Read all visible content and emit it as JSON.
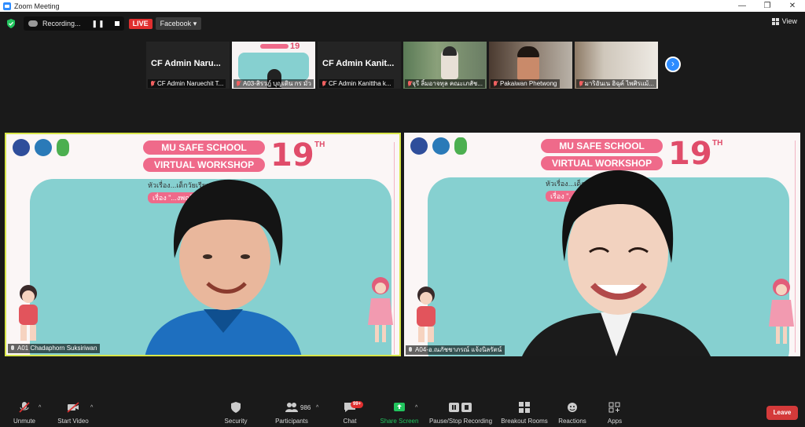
{
  "window": {
    "title": "Zoom Meeting",
    "minimize": "—",
    "maximize": "❐",
    "close": "✕"
  },
  "topbar": {
    "recording_label": "Recording...",
    "live_label": "LIVE",
    "stream_target": "Facebook",
    "stream_caret": "▾",
    "view_label": "View"
  },
  "thumbnails": [
    {
      "big_name": "CF Admin Naru...",
      "label": "CF Admin Naruechit T...",
      "kind": "name"
    },
    {
      "big_name": "",
      "label": "A03-สิรวฎ์ บุญเดิน กร มั่ว",
      "kind": "slide"
    },
    {
      "big_name": "CF Admin Kanit...",
      "label": "CF Admin Kanittha k...",
      "kind": "name"
    },
    {
      "big_name": "",
      "label": "จุรี ลิ้มอาจทุล คณะเภสัช...",
      "kind": "video"
    },
    {
      "big_name": "",
      "label": "Pakaiwan Phetwong",
      "kind": "video"
    },
    {
      "big_name": "",
      "label": "มาริอันเน ฮิฉุค์ ไพศิรแม้...",
      "kind": "video"
    }
  ],
  "next_arrow": "›",
  "tiles": [
    {
      "name": "A01 Chadaphorn Suksiriwan",
      "title_line1": "MU SAFE SCHOOL",
      "title_line2": "VIRTUAL WORKSHOP",
      "edition": "19",
      "edition_suffix": "TH",
      "subtitle1": "หัวเรื่อง...เด็กวัยเรียน(1)\"",
      "subtitle2": "เรื่อง \"...งพฤติกรรม\""
    },
    {
      "name": "A04-อ.ณภัชชาภรณ์ แจ้งนิลรัตน์",
      "title_line1": "MU SAFE SCHOOL",
      "title_line2": "VIRTUAL WORKSHOP",
      "edition": "19",
      "edition_suffix": "TH",
      "subtitle1": "หัวเรื่อง...เด็กวัยเรียน(1)\"",
      "subtitle2": "เรื่อง \"...งพฤติกรรม\""
    }
  ],
  "toolbar": {
    "unmute": "Unmute",
    "start_video": "Start Video",
    "security": "Security",
    "participants": "Participants",
    "participant_count": "986",
    "chat": "Chat",
    "chat_badge": "99+",
    "share_screen": "Share Screen",
    "pause_recording": "Pause/Stop Recording",
    "breakout_rooms": "Breakout Rooms",
    "reactions": "Reactions",
    "apps": "Apps",
    "leave": "Leave",
    "caret": "^"
  },
  "colors": {
    "background": "#1a1a1a",
    "live_red": "#e02f2f",
    "share_green": "#22c55e",
    "active_border": "#d8e64a",
    "zoom_blue": "#2d8cff"
  }
}
